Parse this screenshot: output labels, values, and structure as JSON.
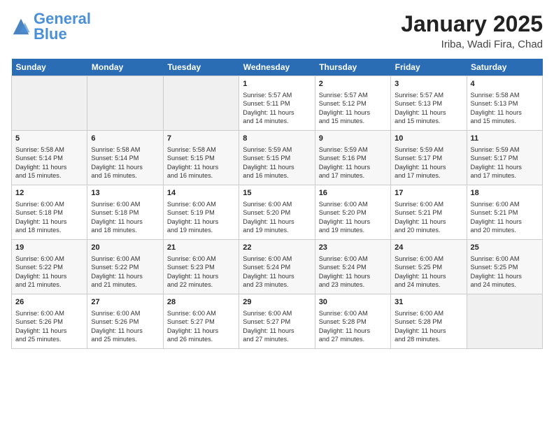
{
  "header": {
    "logo_general": "General",
    "logo_blue": "Blue",
    "title": "January 2025",
    "subtitle": "Iriba, Wadi Fira, Chad"
  },
  "weekdays": [
    "Sunday",
    "Monday",
    "Tuesday",
    "Wednesday",
    "Thursday",
    "Friday",
    "Saturday"
  ],
  "weeks": [
    [
      {
        "day": "",
        "info": ""
      },
      {
        "day": "",
        "info": ""
      },
      {
        "day": "",
        "info": ""
      },
      {
        "day": "1",
        "info": "Sunrise: 5:57 AM\nSunset: 5:11 PM\nDaylight: 11 hours\nand 14 minutes."
      },
      {
        "day": "2",
        "info": "Sunrise: 5:57 AM\nSunset: 5:12 PM\nDaylight: 11 hours\nand 15 minutes."
      },
      {
        "day": "3",
        "info": "Sunrise: 5:57 AM\nSunset: 5:13 PM\nDaylight: 11 hours\nand 15 minutes."
      },
      {
        "day": "4",
        "info": "Sunrise: 5:58 AM\nSunset: 5:13 PM\nDaylight: 11 hours\nand 15 minutes."
      }
    ],
    [
      {
        "day": "5",
        "info": "Sunrise: 5:58 AM\nSunset: 5:14 PM\nDaylight: 11 hours\nand 15 minutes."
      },
      {
        "day": "6",
        "info": "Sunrise: 5:58 AM\nSunset: 5:14 PM\nDaylight: 11 hours\nand 16 minutes."
      },
      {
        "day": "7",
        "info": "Sunrise: 5:58 AM\nSunset: 5:15 PM\nDaylight: 11 hours\nand 16 minutes."
      },
      {
        "day": "8",
        "info": "Sunrise: 5:59 AM\nSunset: 5:15 PM\nDaylight: 11 hours\nand 16 minutes."
      },
      {
        "day": "9",
        "info": "Sunrise: 5:59 AM\nSunset: 5:16 PM\nDaylight: 11 hours\nand 17 minutes."
      },
      {
        "day": "10",
        "info": "Sunrise: 5:59 AM\nSunset: 5:17 PM\nDaylight: 11 hours\nand 17 minutes."
      },
      {
        "day": "11",
        "info": "Sunrise: 5:59 AM\nSunset: 5:17 PM\nDaylight: 11 hours\nand 17 minutes."
      }
    ],
    [
      {
        "day": "12",
        "info": "Sunrise: 6:00 AM\nSunset: 5:18 PM\nDaylight: 11 hours\nand 18 minutes."
      },
      {
        "day": "13",
        "info": "Sunrise: 6:00 AM\nSunset: 5:18 PM\nDaylight: 11 hours\nand 18 minutes."
      },
      {
        "day": "14",
        "info": "Sunrise: 6:00 AM\nSunset: 5:19 PM\nDaylight: 11 hours\nand 19 minutes."
      },
      {
        "day": "15",
        "info": "Sunrise: 6:00 AM\nSunset: 5:20 PM\nDaylight: 11 hours\nand 19 minutes."
      },
      {
        "day": "16",
        "info": "Sunrise: 6:00 AM\nSunset: 5:20 PM\nDaylight: 11 hours\nand 19 minutes."
      },
      {
        "day": "17",
        "info": "Sunrise: 6:00 AM\nSunset: 5:21 PM\nDaylight: 11 hours\nand 20 minutes."
      },
      {
        "day": "18",
        "info": "Sunrise: 6:00 AM\nSunset: 5:21 PM\nDaylight: 11 hours\nand 20 minutes."
      }
    ],
    [
      {
        "day": "19",
        "info": "Sunrise: 6:00 AM\nSunset: 5:22 PM\nDaylight: 11 hours\nand 21 minutes."
      },
      {
        "day": "20",
        "info": "Sunrise: 6:00 AM\nSunset: 5:22 PM\nDaylight: 11 hours\nand 21 minutes."
      },
      {
        "day": "21",
        "info": "Sunrise: 6:00 AM\nSunset: 5:23 PM\nDaylight: 11 hours\nand 22 minutes."
      },
      {
        "day": "22",
        "info": "Sunrise: 6:00 AM\nSunset: 5:24 PM\nDaylight: 11 hours\nand 23 minutes."
      },
      {
        "day": "23",
        "info": "Sunrise: 6:00 AM\nSunset: 5:24 PM\nDaylight: 11 hours\nand 23 minutes."
      },
      {
        "day": "24",
        "info": "Sunrise: 6:00 AM\nSunset: 5:25 PM\nDaylight: 11 hours\nand 24 minutes."
      },
      {
        "day": "25",
        "info": "Sunrise: 6:00 AM\nSunset: 5:25 PM\nDaylight: 11 hours\nand 24 minutes."
      }
    ],
    [
      {
        "day": "26",
        "info": "Sunrise: 6:00 AM\nSunset: 5:26 PM\nDaylight: 11 hours\nand 25 minutes."
      },
      {
        "day": "27",
        "info": "Sunrise: 6:00 AM\nSunset: 5:26 PM\nDaylight: 11 hours\nand 25 minutes."
      },
      {
        "day": "28",
        "info": "Sunrise: 6:00 AM\nSunset: 5:27 PM\nDaylight: 11 hours\nand 26 minutes."
      },
      {
        "day": "29",
        "info": "Sunrise: 6:00 AM\nSunset: 5:27 PM\nDaylight: 11 hours\nand 27 minutes."
      },
      {
        "day": "30",
        "info": "Sunrise: 6:00 AM\nSunset: 5:28 PM\nDaylight: 11 hours\nand 27 minutes."
      },
      {
        "day": "31",
        "info": "Sunrise: 6:00 AM\nSunset: 5:28 PM\nDaylight: 11 hours\nand 28 minutes."
      },
      {
        "day": "",
        "info": ""
      }
    ]
  ]
}
